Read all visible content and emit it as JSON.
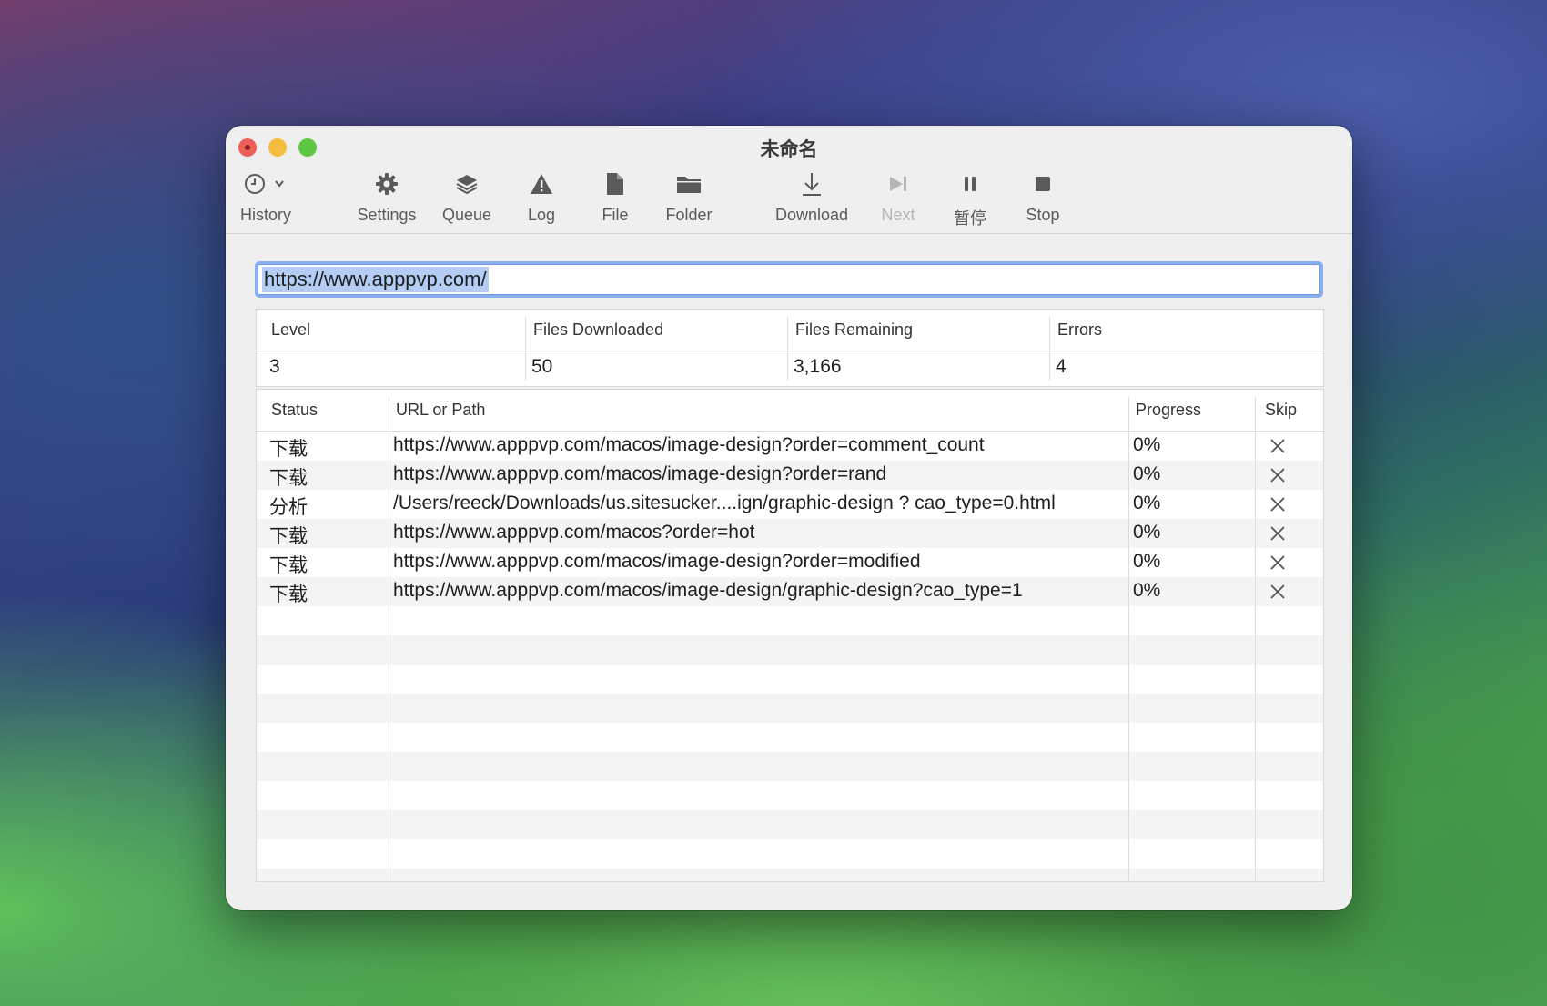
{
  "window": {
    "title": "未命名"
  },
  "toolbar": {
    "history": "History",
    "settings": "Settings",
    "queue": "Queue",
    "log": "Log",
    "file": "File",
    "folder": "Folder",
    "download": "Download",
    "next": "Next",
    "pause": "暂停",
    "stop": "Stop"
  },
  "url_field": {
    "value": "https://www.apppvp.com/"
  },
  "stats": {
    "headers": [
      "Level",
      "Files Downloaded",
      "Files Remaining",
      "Errors"
    ],
    "values": [
      "3",
      "50",
      "3,166",
      "4"
    ]
  },
  "list": {
    "headers": [
      "Status",
      "URL or Path",
      "Progress",
      "Skip"
    ],
    "rows": [
      {
        "status": "下载",
        "url": "https://www.apppvp.com/macos/image-design?order=comment_count",
        "progress": "0%"
      },
      {
        "status": "下载",
        "url": "https://www.apppvp.com/macos/image-design?order=rand",
        "progress": "0%"
      },
      {
        "status": "分析",
        "url": "/Users/reeck/Downloads/us.sitesucker....ign/graphic-design ? cao_type=0.html",
        "progress": "0%"
      },
      {
        "status": "下载",
        "url": "https://www.apppvp.com/macos?order=hot",
        "progress": "0%"
      },
      {
        "status": "下载",
        "url": "https://www.apppvp.com/macos/image-design?order=modified",
        "progress": "0%"
      },
      {
        "status": "下载",
        "url": "https://www.apppvp.com/macos/image-design/graphic-design?cao_type=1",
        "progress": "0%"
      }
    ]
  }
}
